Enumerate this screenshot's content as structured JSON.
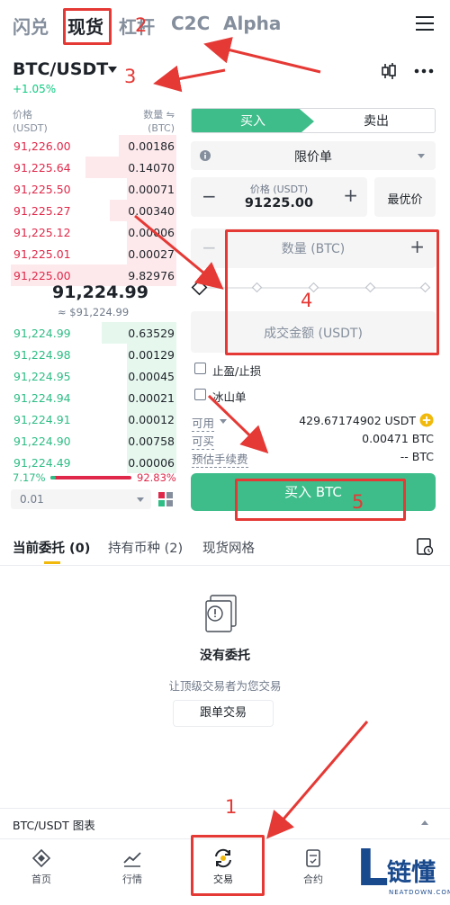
{
  "top_tabs": [
    {
      "label": "闪兑"
    },
    {
      "label": "现货"
    },
    {
      "label": "杠杆"
    },
    {
      "label": "C2C"
    },
    {
      "label": "Alpha"
    }
  ],
  "pair": {
    "name": "BTC/USDT",
    "change": "+1.05%"
  },
  "orderbook": {
    "price_header": "价格",
    "price_unit": "(USDT)",
    "qty_header": "数量 ⇋",
    "qty_unit": "(BTC)",
    "asks": [
      {
        "price": "91,226.00",
        "qty": "0.00186",
        "depth": 0.35
      },
      {
        "price": "91,225.64",
        "qty": "0.14070",
        "depth": 0.55
      },
      {
        "price": "91,225.50",
        "qty": "0.00071",
        "depth": 0.3
      },
      {
        "price": "91,225.27",
        "qty": "0.00340",
        "depth": 0.4
      },
      {
        "price": "91,225.12",
        "qty": "0.00006",
        "depth": 0.3
      },
      {
        "price": "91,225.01",
        "qty": "0.00027",
        "depth": 0.3
      },
      {
        "price": "91,225.00",
        "qty": "9.82976",
        "depth": 1.0
      }
    ],
    "mid_price": "91,224.99",
    "mid_fiat": "≈ $91,224.99",
    "bids": [
      {
        "price": "91,224.99",
        "qty": "0.63529",
        "depth": 0.45
      },
      {
        "price": "91,224.98",
        "qty": "0.00129",
        "depth": 0.3
      },
      {
        "price": "91,224.95",
        "qty": "0.00045",
        "depth": 0.3
      },
      {
        "price": "91,224.94",
        "qty": "0.00021",
        "depth": 0.3
      },
      {
        "price": "91,224.91",
        "qty": "0.00012",
        "depth": 0.3
      },
      {
        "price": "91,224.90",
        "qty": "0.00758",
        "depth": 0.3
      },
      {
        "price": "91,224.49",
        "qty": "0.00006",
        "depth": 0.3
      }
    ],
    "buy_ratio": "7.17%",
    "sell_ratio": "92.83%",
    "buy_ratio_value": 0.0717,
    "precision": "0.01"
  },
  "order_form": {
    "buy_label": "买入",
    "sell_label": "卖出",
    "order_type": "限价单",
    "price_label": "价格 (USDT)",
    "price_value": "91225.00",
    "best_price": "最优价",
    "qty_placeholder": "数量 (BTC)",
    "amount_placeholder": "成交金额 (USDT)",
    "tp_sl": "止盈/止损",
    "iceberg": "冰山单",
    "available_label": "可用",
    "available_value": "429.67174902 USDT",
    "can_buy_label": "可买",
    "can_buy_value": "0.00471 BTC",
    "fee_label": "预估手续费",
    "fee_value": "-- BTC",
    "submit": "买入 BTC"
  },
  "lower_tabs": {
    "open_orders": "当前委托 (0)",
    "holdings": "持有币种 (2)",
    "grid": "现货网格"
  },
  "empty": {
    "title": "没有委托",
    "subtitle": "让顶级交易者为您交易",
    "copy_button": "跟单交易"
  },
  "chart_bar": "BTC/USDT 图表",
  "bottom_nav": [
    {
      "label": "首页"
    },
    {
      "label": "行情"
    },
    {
      "label": "交易"
    },
    {
      "label": "合约"
    }
  ],
  "watermark": {
    "mark": "L",
    "text": "链懂",
    "sub": "NEATDOWN.COM"
  },
  "annotations": [
    "1",
    "2",
    "3",
    "4",
    "5"
  ],
  "colors": {
    "buy": "#3ebd8a",
    "sell": "#e0294a",
    "annotation": "#e53935",
    "accent": "#f0b90b"
  }
}
